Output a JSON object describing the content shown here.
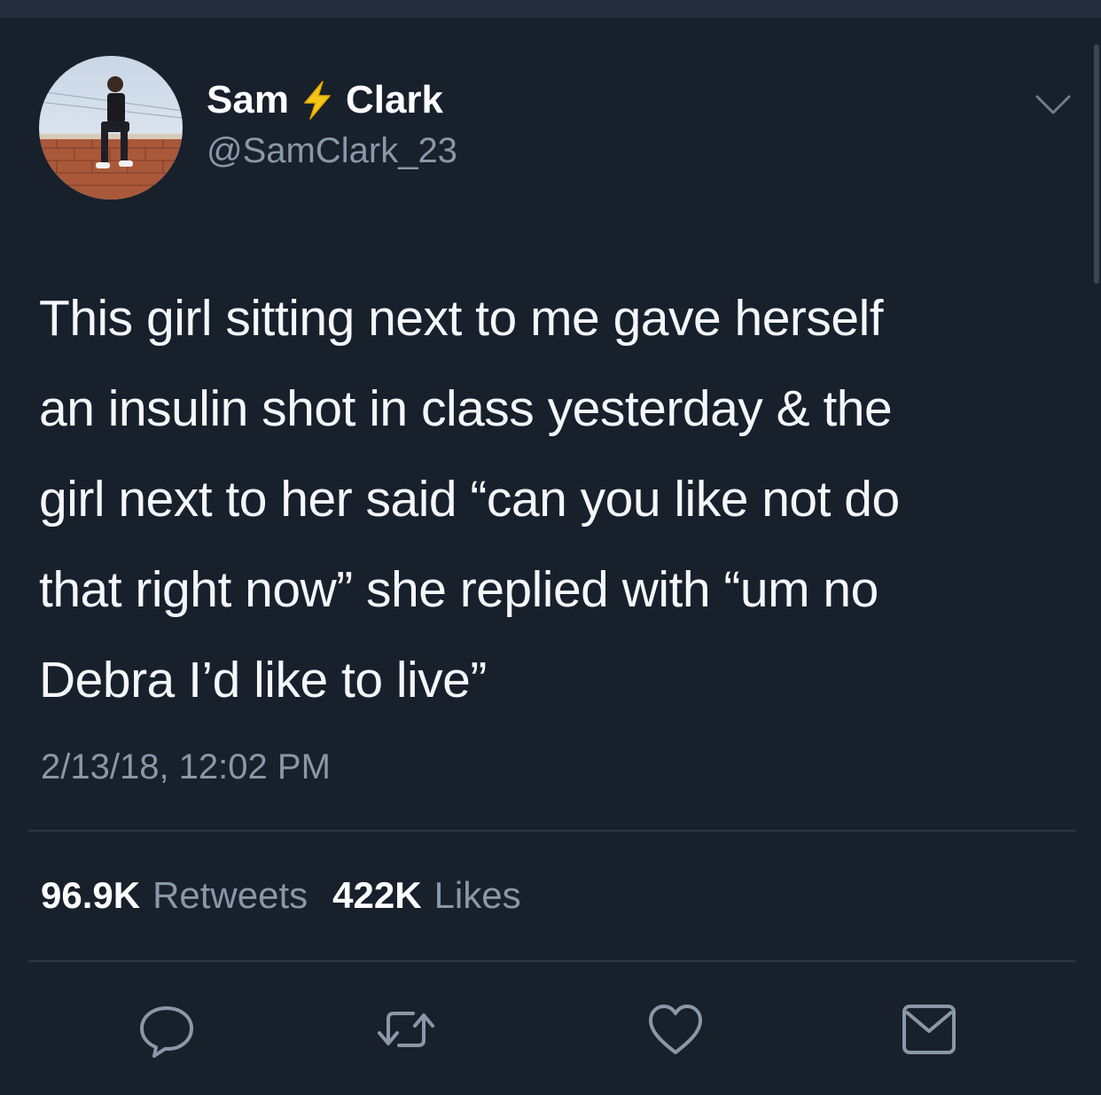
{
  "author": {
    "name_first": "Sam",
    "name_last": "Clark",
    "handle": "@SamClark_23"
  },
  "tweet": {
    "lines": [
      "This girl sitting next to me gave herself",
      "an insulin shot in class yesterday & the",
      "girl next to her said “can you like not do",
      "that right now” she replied with “um no",
      "Debra I’d like to live”"
    ],
    "timestamp": "2/13/18, 12:02 PM"
  },
  "stats": {
    "retweets_count": "96.9K",
    "retweets_label": "Retweets",
    "likes_count": "422K",
    "likes_label": "Likes"
  },
  "icons": {
    "name_emoji": "bolt-icon",
    "menu": "chevron-down-icon",
    "actions": [
      "reply-icon",
      "retweet-icon",
      "like-icon",
      "direct-message-icon"
    ]
  },
  "colors": {
    "background": "#18202c",
    "text_primary": "#f5f7fa",
    "text_secondary": "#8a97a8",
    "bolt": "#f5c518"
  }
}
